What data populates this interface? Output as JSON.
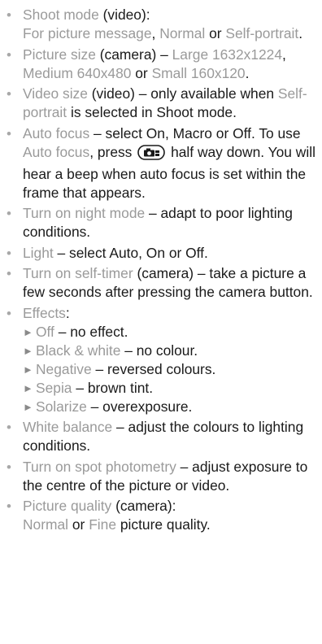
{
  "items": [
    {
      "term": "Shoot mode",
      "after_term": " (video):",
      "l2_o1": "For picture message",
      "l2_t1": ", ",
      "l2_o2": "Normal",
      "l2_t2": " or ",
      "l2_o3": "Self-portrait",
      "l2_t3": "."
    },
    {
      "term": "Picture size",
      "t1": " (camera) – ",
      "o1": "Large 1632x1224",
      "t2": ", ",
      "o2": "Medium 640x480",
      "t3": " or ",
      "o3": "Small 160x120",
      "t4": "."
    },
    {
      "term": "Video size",
      "t1": " (video) – only available when ",
      "o1": "Self-portrait",
      "t2": " is selected in Shoot mode."
    },
    {
      "term": "Auto focus",
      "t1": " – select On, Macro or Off. To use ",
      "o1": "Auto focus",
      "t2": ", press",
      "key_icon": "camera-key-icon",
      "t3": "half way down. You will hear a beep when auto focus is set within the frame that appears."
    },
    {
      "term": "Turn on night mode",
      "t1": " – adapt to poor lighting conditions."
    },
    {
      "term": "Light",
      "t1": " – select Auto, On or Off."
    },
    {
      "term": "Turn on self-timer",
      "t1": " (camera) – take a picture a few seconds after pressing the camera button."
    },
    {
      "term": "Effects",
      "t1": ":",
      "subs": [
        {
          "term": "Off",
          "desc": " – no effect."
        },
        {
          "term": "Black & white",
          "desc": " – no colour."
        },
        {
          "term": "Negative",
          "desc": " – reversed colours."
        },
        {
          "term": "Sepia",
          "desc": " – brown tint."
        },
        {
          "term": "Solarize",
          "desc": " – overexposure."
        }
      ]
    },
    {
      "term": "White balance",
      "t1": " – adjust the colours to lighting conditions."
    },
    {
      "term": "Turn on spot photometry",
      "t1": " – adjust exposure to the centre of the picture or video."
    },
    {
      "term": "Picture quality",
      "t1": " (camera):",
      "o1": "Normal",
      "t2": " or ",
      "o2": "Fine",
      "t3": " picture quality."
    }
  ],
  "glyphs": {
    "bullet": "•",
    "arrow": "►"
  },
  "colors": {
    "highlight": "#9a9a9a",
    "text": "#1a1a1a",
    "bullet": "#a8a8a8"
  }
}
